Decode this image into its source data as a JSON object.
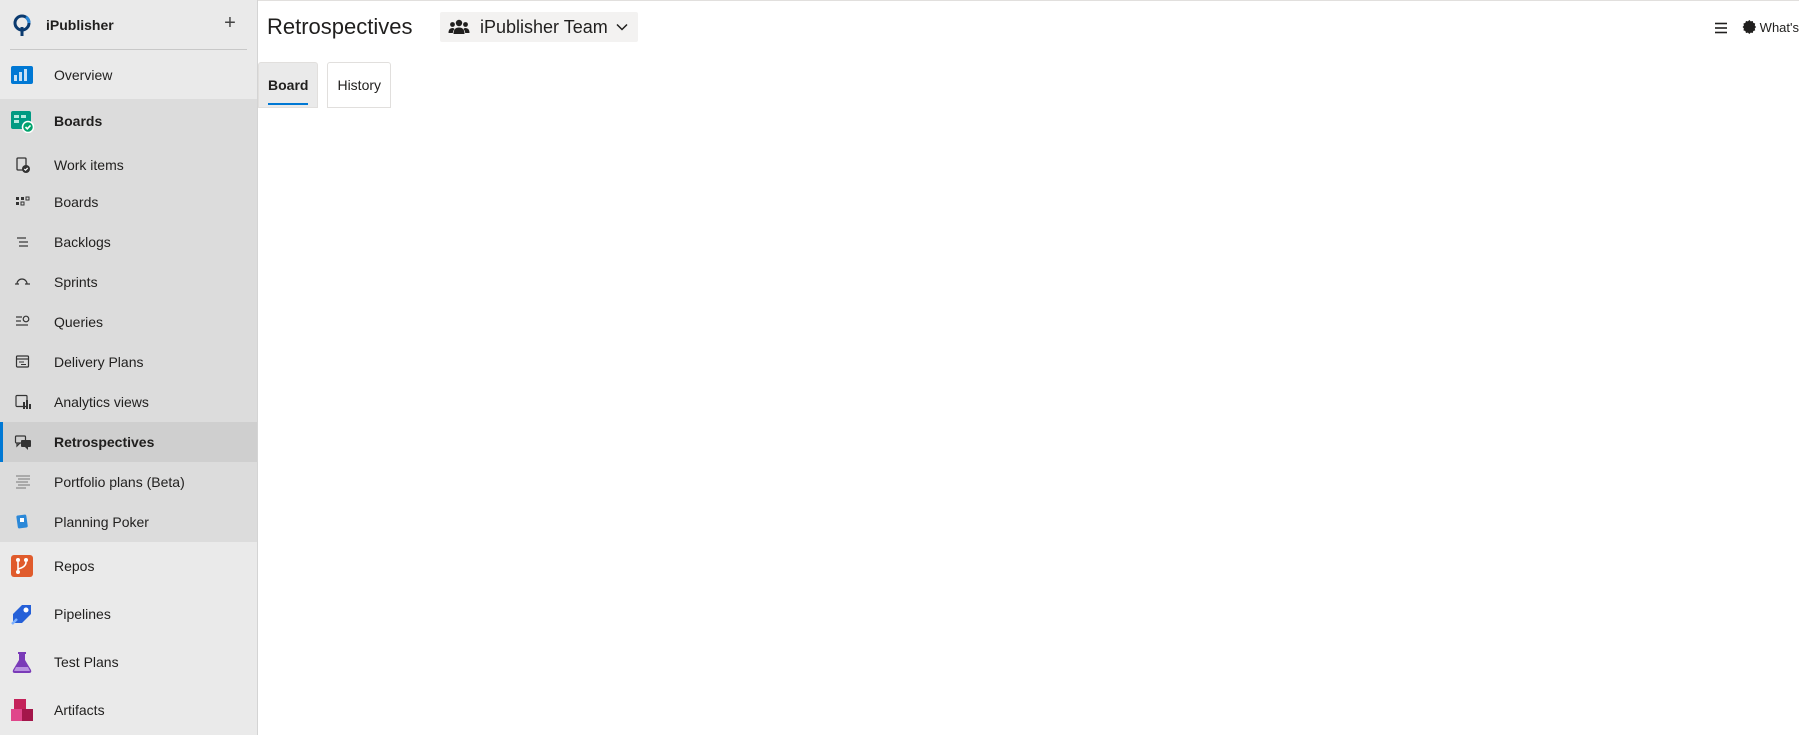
{
  "project": {
    "name": "iPublisher",
    "add_symbol": "+"
  },
  "nav": {
    "overview": "Overview",
    "boards": "Boards",
    "boards_items": [
      "Work items",
      "Boards",
      "Backlogs",
      "Sprints",
      "Queries",
      "Delivery Plans",
      "Analytics views",
      "Retrospectives",
      "Portfolio plans (Beta)",
      "Planning Poker"
    ],
    "repos": "Repos",
    "pipelines": "Pipelines",
    "test_plans": "Test Plans",
    "artifacts": "Artifacts"
  },
  "header": {
    "title": "Retrospectives",
    "team": "iPublisher Team",
    "whats_new": "What's"
  },
  "tabs": [
    "Board",
    "History"
  ],
  "colors": {
    "accent": "#0078d4",
    "sidebar_bg": "#eaeaea",
    "selected_bg": "#cfcfcf"
  }
}
